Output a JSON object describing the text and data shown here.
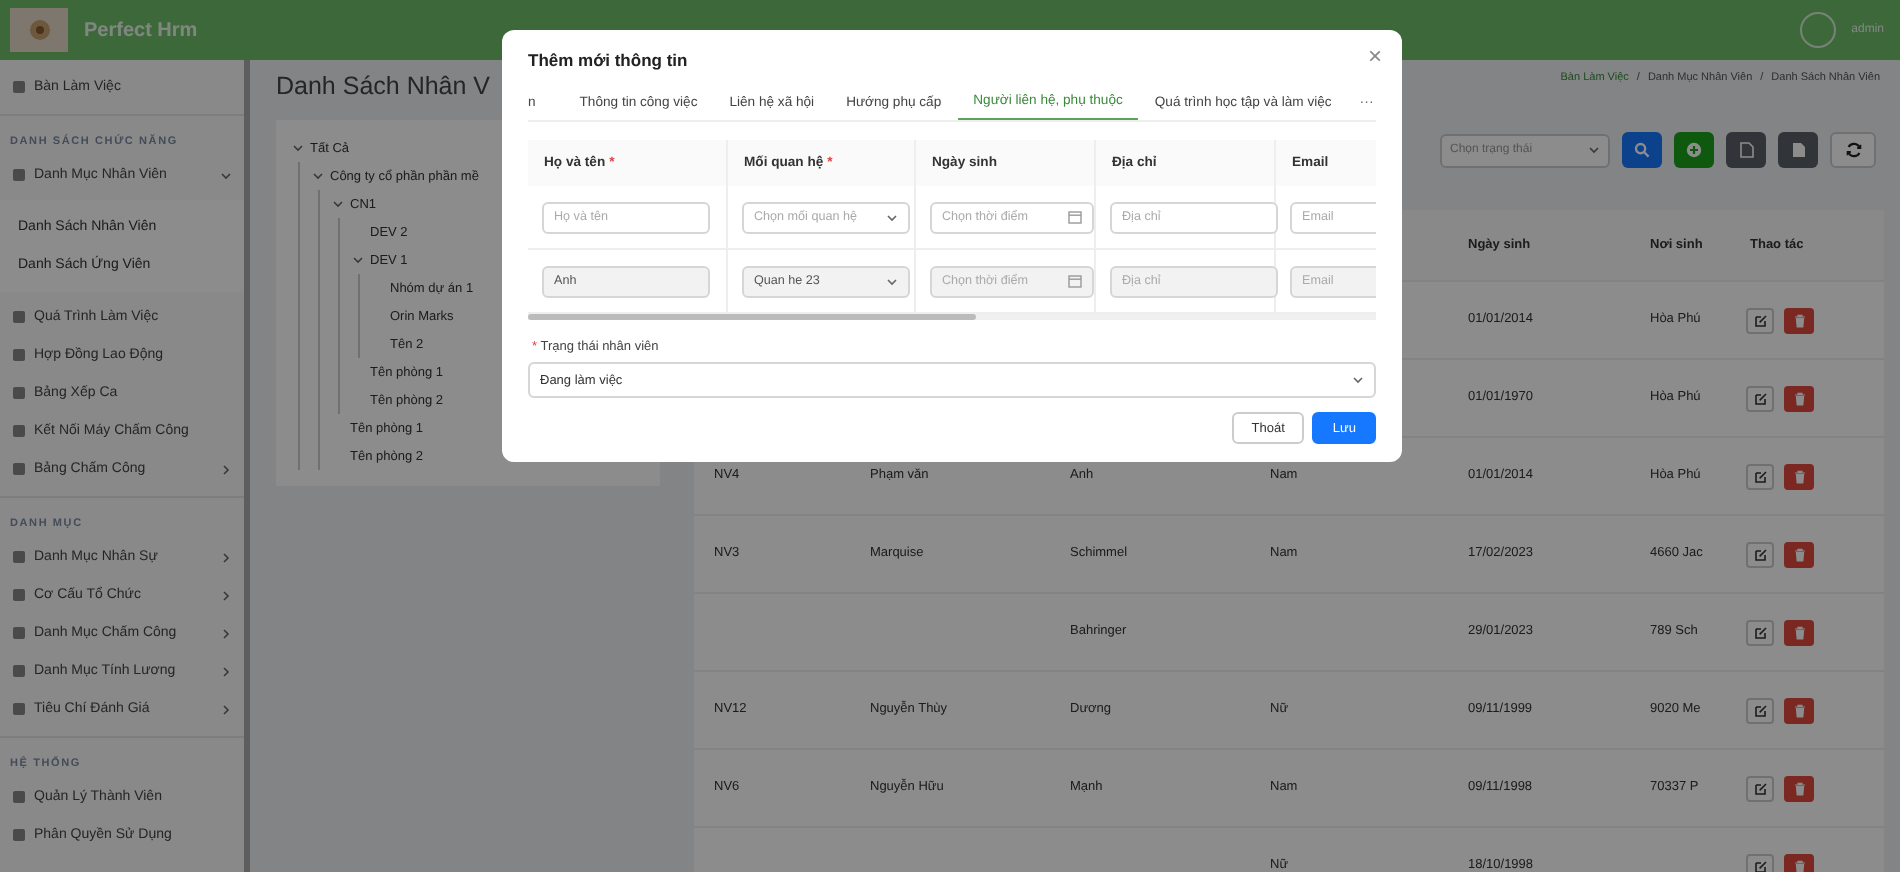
{
  "header": {
    "app_name": "Perfect Hrm",
    "user": "admin"
  },
  "sidebar": {
    "items": [
      {
        "kind": "item",
        "label": "Bàn Làm Việc"
      },
      {
        "kind": "header",
        "label": "DANH SÁCH CHỨC NĂNG"
      },
      {
        "kind": "group",
        "label": "Danh Mục Nhân Viên",
        "expanded": true
      },
      {
        "kind": "subitem",
        "label": "Danh Sách Nhân Viên"
      },
      {
        "kind": "subitem",
        "label": "Danh Sách Ứng Viên"
      },
      {
        "kind": "item",
        "label": "Quá Trình Làm Việc"
      },
      {
        "kind": "item",
        "label": "Hợp Đồng Lao Động"
      },
      {
        "kind": "item",
        "label": "Bảng Xếp Ca"
      },
      {
        "kind": "item",
        "label": "Kết Nối Máy Chấm Công"
      },
      {
        "kind": "group",
        "label": "Bảng Chấm Công",
        "expanded": false
      },
      {
        "kind": "header",
        "label": "DANH MỤC"
      },
      {
        "kind": "group",
        "label": "Danh Mục Nhân Sự",
        "expanded": false
      },
      {
        "kind": "group",
        "label": "Cơ Cấu Tổ Chức",
        "expanded": false
      },
      {
        "kind": "group",
        "label": "Danh Mục Chấm Công",
        "expanded": false
      },
      {
        "kind": "group",
        "label": "Danh Mục Tính Lương",
        "expanded": false
      },
      {
        "kind": "group",
        "label": "Tiêu Chí Đánh Giá",
        "expanded": false
      },
      {
        "kind": "header",
        "label": "HỆ THỐNG"
      },
      {
        "kind": "item",
        "label": "Quản Lý Thành Viên"
      },
      {
        "kind": "item",
        "label": "Phân Quyền Sử Dụng"
      }
    ]
  },
  "page": {
    "title": "Danh Sách Nhân V",
    "breadcrumb": [
      {
        "kind": "link",
        "label": "Bàn Làm Việc"
      },
      {
        "kind": "text",
        "label": "Danh Mục Nhân Viên"
      },
      {
        "kind": "text",
        "label": "Danh Sách Nhân Viên"
      }
    ],
    "separator": "/"
  },
  "tree": [
    {
      "label": "Tất Cả",
      "expanded": true,
      "children": [
        {
          "label": "Công ty cổ phần phần mề",
          "expanded": true,
          "children": [
            {
              "label": "CN1",
              "expanded": true,
              "children": [
                {
                  "label": "DEV 2"
                },
                {
                  "label": "DEV 1",
                  "expanded": true,
                  "children": [
                    {
                      "label": "Nhóm dự án 1"
                    },
                    {
                      "label": "Orin Marks"
                    },
                    {
                      "label": "Tên 2"
                    }
                  ]
                },
                {
                  "label": "Tên phòng 1"
                },
                {
                  "label": "Tên phòng 2"
                }
              ]
            },
            {
              "label": "Tên phòng 1"
            },
            {
              "label": "Tên phòng 2"
            }
          ]
        }
      ]
    }
  ],
  "toolbar": {
    "status_select": {
      "placeholder": "Chọn trạng thái"
    },
    "buttons": [
      {
        "kind": "search"
      },
      {
        "kind": "add"
      },
      {
        "kind": "export"
      },
      {
        "kind": "import"
      },
      {
        "kind": "refresh"
      }
    ]
  },
  "employee_table": {
    "columns": [
      "Ngày sinh",
      "Nơi sinh",
      "Thao tác"
    ],
    "rows": [
      {
        "birth_date": "01/01/2014",
        "birth_place": "Hòa Phú"
      },
      {
        "birth_date": "01/01/1970",
        "birth_place": "Hòa Phú"
      },
      {
        "column_1": "NV4",
        "column_2": "Phạm văn",
        "column_3": "Anh",
        "column_4": "Nam",
        "birth_date": "01/01/2014",
        "birth_place": "Hòa Phú"
      },
      {
        "column_1": "NV3",
        "column_2": "Marquise",
        "column_3": "Schimmel",
        "column_4": "Nam",
        "birth_date": "17/02/2023",
        "birth_place": "4660 Jac"
      },
      {
        "column_3": "Bahringer",
        "birth_date": "29/01/2023",
        "birth_place": "789 Sch"
      },
      {
        "column_1": "NV12",
        "column_2": "Nguyễn Thùy",
        "column_3": "Dương",
        "column_4": "Nữ",
        "birth_date": "09/11/1999",
        "birth_place": "9020 Me"
      },
      {
        "column_1": "NV6",
        "column_2": "Nguyễn Hữu",
        "column_3": "Mạnh",
        "column_4": "Nam",
        "birth_date": "09/11/1998",
        "birth_place": "70337 P"
      },
      {
        "column_4": "Nữ",
        "birth_date": "18/10/1998"
      }
    ]
  },
  "dialog": {
    "title": "Thêm mới thông tin",
    "close": "×",
    "tabs": [
      {
        "label": "n",
        "selected": false
      },
      {
        "label": "Thông tin công việc",
        "selected": false
      },
      {
        "label": "Liên hệ xã hội",
        "selected": false
      },
      {
        "label": "Hướng phụ cấp",
        "selected": false
      },
      {
        "label": "Người liên hệ, phụ thuộc",
        "selected": true
      },
      {
        "label": "Quá trình học tập và làm việc",
        "selected": false
      }
    ],
    "more": "···",
    "columns": [
      {
        "label": "Họ và tên",
        "mark": "*"
      },
      {
        "label": "Mối quan hệ",
        "mark": "*"
      },
      {
        "label": "Ngày sinh"
      },
      {
        "label": "Địa chỉ"
      },
      {
        "label": "Email"
      }
    ],
    "rows": [
      {
        "disabled": false,
        "cells": [
          {
            "kind": "input",
            "placeholder": "Họ và tên"
          },
          {
            "kind": "select",
            "placeholder": "Chọn mối quan hệ"
          },
          {
            "kind": "date",
            "placeholder": "Chọn thời điểm"
          },
          {
            "kind": "input",
            "placeholder": "Địa chỉ"
          },
          {
            "kind": "input",
            "placeholder": "Email"
          }
        ]
      },
      {
        "disabled": true,
        "cells": [
          {
            "kind": "input",
            "value": "Anh"
          },
          {
            "kind": "select",
            "value": "Quan he 23"
          },
          {
            "kind": "date",
            "placeholder": "Chọn thời điểm"
          },
          {
            "kind": "input",
            "placeholder": "Địa chỉ"
          },
          {
            "kind": "input",
            "placeholder": "Email"
          }
        ]
      }
    ],
    "status_field": {
      "mark": "*",
      "label": "Trạng thái nhân viên",
      "value": "Đang làm việc"
    },
    "buttons": [
      {
        "kind": "secondary",
        "label": "Thoát"
      },
      {
        "kind": "primary",
        "label": "Lưu"
      }
    ]
  }
}
